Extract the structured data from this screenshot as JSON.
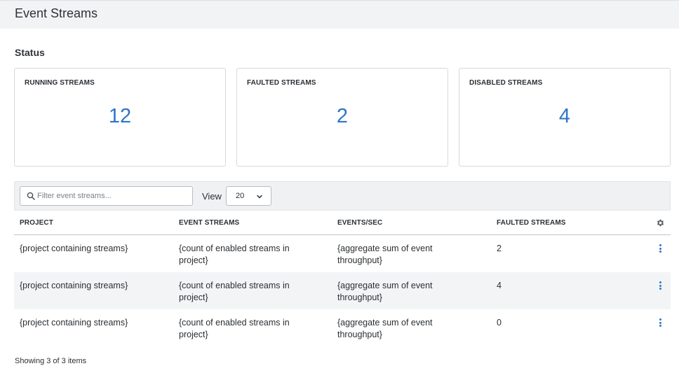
{
  "page": {
    "title": "Event Streams"
  },
  "status": {
    "title": "Status",
    "cards": [
      {
        "label": "RUNNING STREAMS",
        "value": "12"
      },
      {
        "label": "FAULTED STREAMS",
        "value": "2"
      },
      {
        "label": "DISABLED STREAMS",
        "value": "4"
      }
    ]
  },
  "toolbar": {
    "search_placeholder": "Filter event streams...",
    "search_value": "",
    "view_label": "View",
    "view_value": "20"
  },
  "table": {
    "headers": [
      "PROJECT",
      "EVENT STREAMS",
      "EVENTS/SEC",
      "FAULTED STREAMS"
    ],
    "rows": [
      {
        "project": "{project containing streams}",
        "event_streams": "{count of enabled streams in project}",
        "events_sec": "{aggregate sum of event throughput}",
        "faulted": "2"
      },
      {
        "project": "{project containing streams}",
        "event_streams": "{count of enabled streams in project}",
        "events_sec": "{aggregate sum of event throughput}",
        "faulted": "4"
      },
      {
        "project": "{project containing streams}",
        "event_streams": "{count of enabled streams in project}",
        "events_sec": "{aggregate sum of event throughput}",
        "faulted": "0"
      }
    ]
  },
  "footer": {
    "text": "Showing 3 of 3 items"
  },
  "colors": {
    "accent": "#2f74c8",
    "header_bg": "#f2f3f5",
    "row_alt_bg": "#f3f4f6"
  },
  "icons": {
    "search": "search-icon",
    "chevron": "chevron-down-icon",
    "settings": "gear-icon",
    "row_menu": "kebab-menu-icon"
  }
}
